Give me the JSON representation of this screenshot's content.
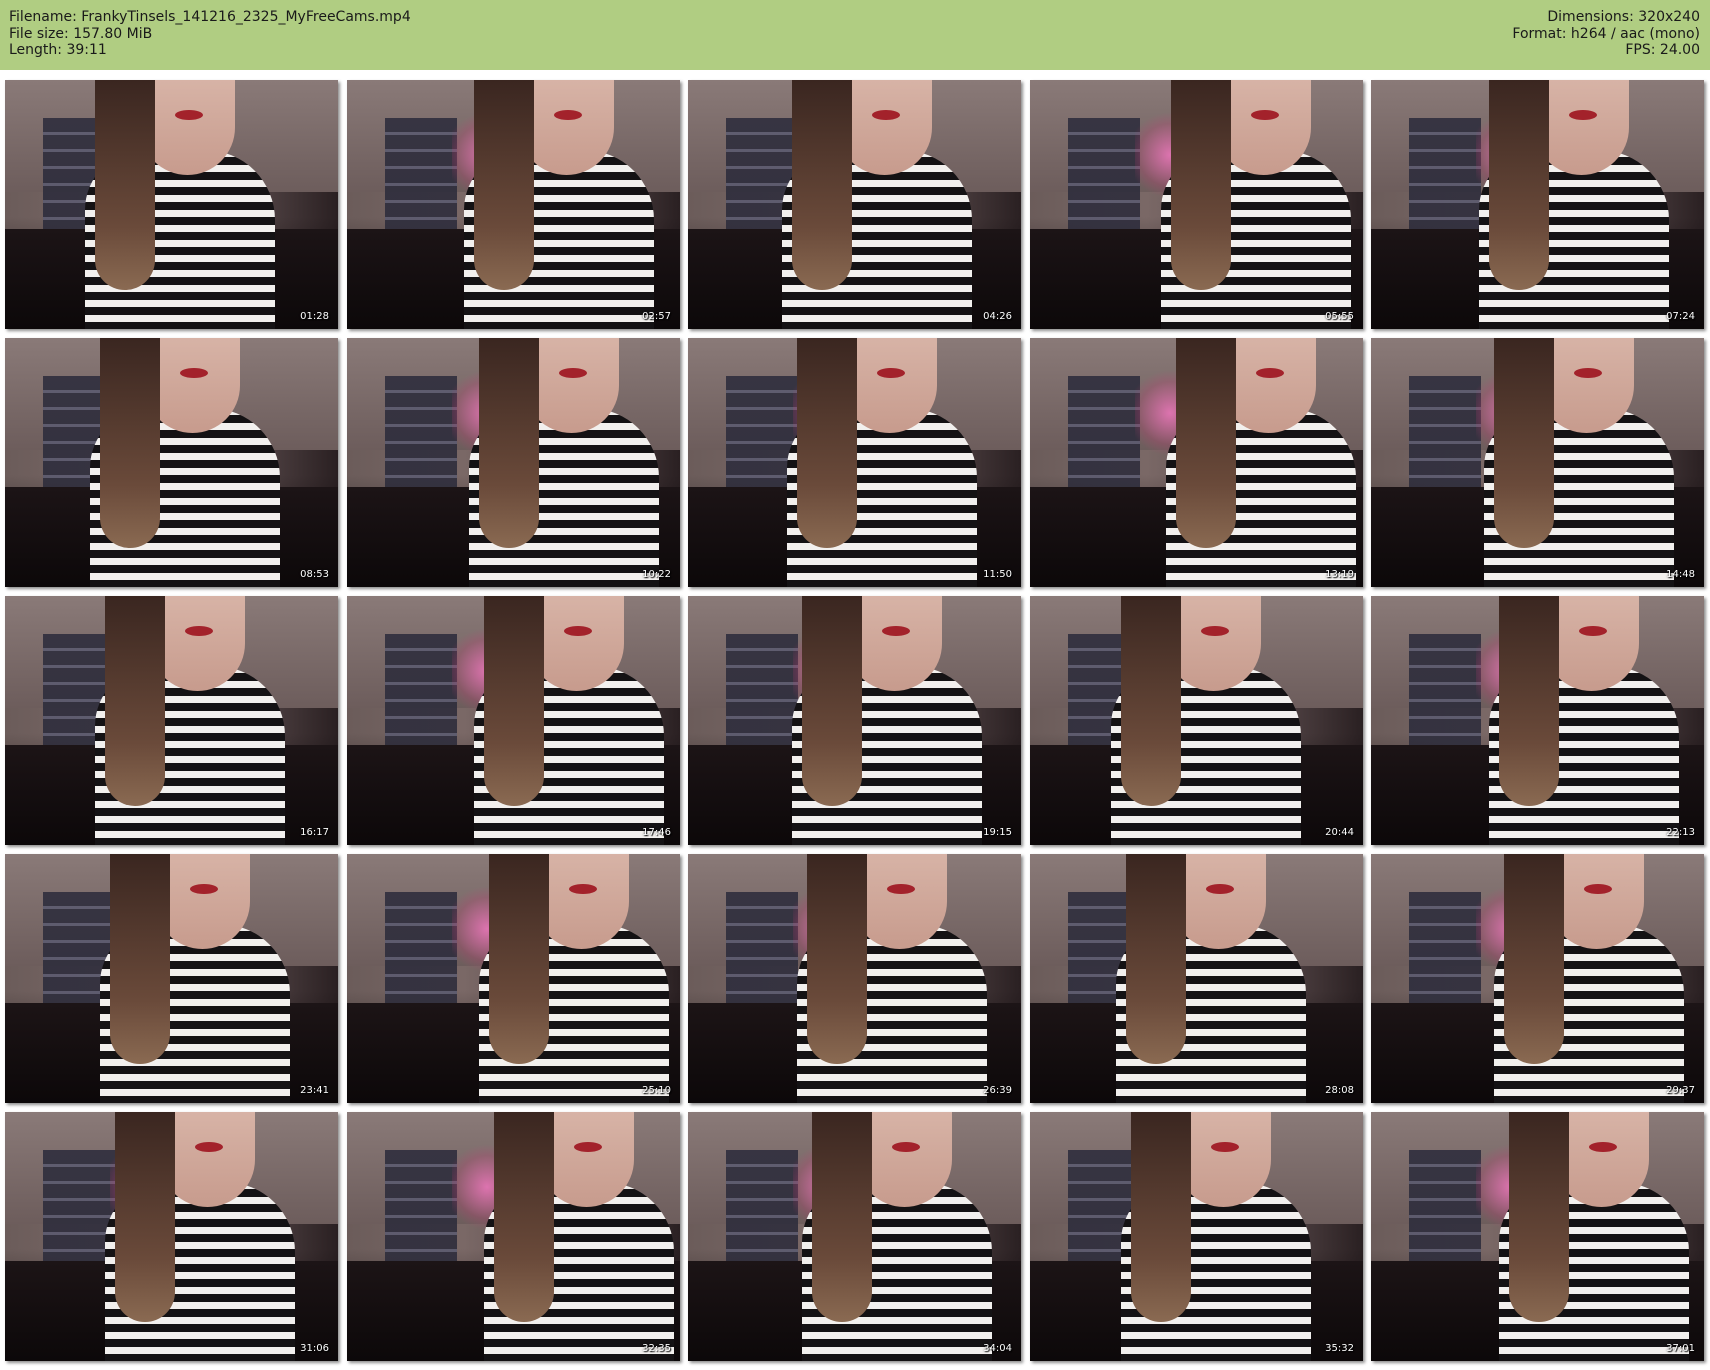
{
  "header": {
    "left": [
      "Filename: FrankyTinsels_141216_2325_MyFreeCams.mp4",
      "File size: 157.80 MiB",
      "Length: 39:11"
    ],
    "right": [
      "Dimensions: 320x240",
      "Format: h264 / aac (mono)",
      "FPS: 24.00"
    ]
  },
  "colors": {
    "header_background": "#b0cd82",
    "page_background": "#ffffff"
  },
  "thumbnails": [
    {
      "timestamp": "01:28"
    },
    {
      "timestamp": "02:57"
    },
    {
      "timestamp": "04:26"
    },
    {
      "timestamp": "05:55"
    },
    {
      "timestamp": "07:24"
    },
    {
      "timestamp": "08:53"
    },
    {
      "timestamp": "10:22"
    },
    {
      "timestamp": "11:50"
    },
    {
      "timestamp": "13:19"
    },
    {
      "timestamp": "14:48"
    },
    {
      "timestamp": "16:17"
    },
    {
      "timestamp": "17:46"
    },
    {
      "timestamp": "19:15"
    },
    {
      "timestamp": "20:44"
    },
    {
      "timestamp": "22:13"
    },
    {
      "timestamp": "23:41"
    },
    {
      "timestamp": "25:10"
    },
    {
      "timestamp": "26:39"
    },
    {
      "timestamp": "28:08"
    },
    {
      "timestamp": "29:37"
    },
    {
      "timestamp": "31:06"
    },
    {
      "timestamp": "32:35"
    },
    {
      "timestamp": "34:04"
    },
    {
      "timestamp": "35:32"
    },
    {
      "timestamp": "37:01"
    }
  ]
}
